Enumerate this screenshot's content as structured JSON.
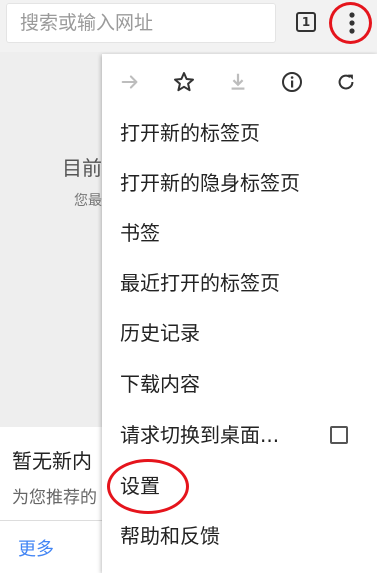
{
  "omnibox": {
    "placeholder": "搜索或输入网址"
  },
  "toolbar": {
    "tab_count": "1"
  },
  "background_page": {
    "headline_partial": "目前",
    "sub_partial": "您最",
    "card_title_partial": "暂无新内",
    "card_sub_partial": "为您推荐的",
    "more_label": "更多"
  },
  "menu": {
    "top_icons": [
      "forward-icon",
      "star-icon",
      "download-icon",
      "info-icon",
      "refresh-icon"
    ],
    "items": [
      {
        "label": "打开新的标签页"
      },
      {
        "label": "打开新的隐身标签页"
      },
      {
        "label": "书签"
      },
      {
        "label": "最近打开的标签页"
      },
      {
        "label": "历史记录"
      },
      {
        "label": "下载内容"
      },
      {
        "label": "请求切换到桌面..."
      },
      {
        "label": "设置"
      },
      {
        "label": "帮助和反馈"
      }
    ]
  },
  "colors": {
    "highlight_ring": "#e5141c",
    "link_blue": "#4285f4"
  }
}
